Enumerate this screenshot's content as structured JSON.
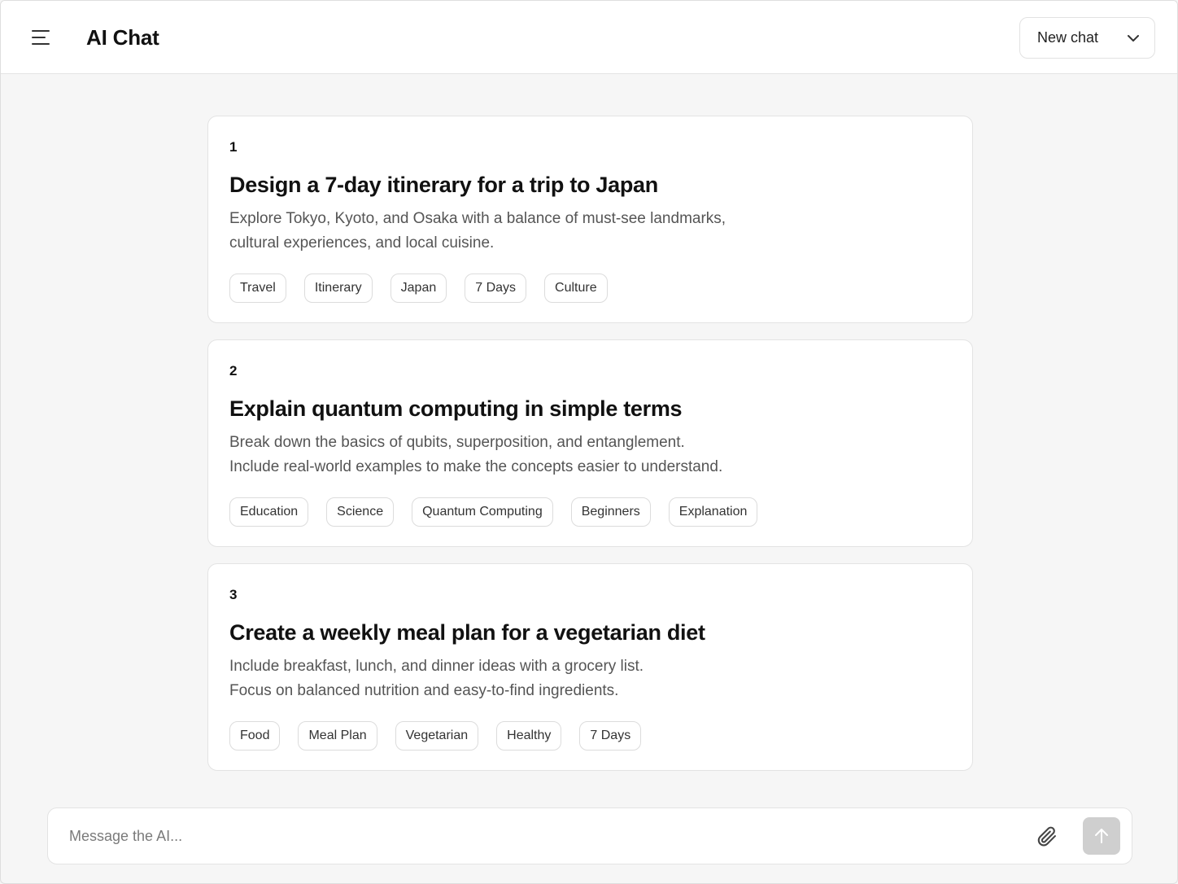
{
  "header": {
    "title": "AI Chat",
    "new_chat_label": "New chat"
  },
  "cards": [
    {
      "number": "1",
      "title": "Design a 7-day itinerary for a trip to Japan",
      "description_lines": [
        "Explore Tokyo, Kyoto, and Osaka with a balance of must-see landmarks,",
        "cultural experiences, and local cuisine."
      ],
      "tags": [
        "Travel",
        "Itinerary",
        "Japan",
        "7 Days",
        "Culture"
      ]
    },
    {
      "number": "2",
      "title": "Explain quantum computing in simple terms",
      "description_lines": [
        "Break down the basics of qubits, superposition, and entanglement.",
        "Include real-world examples to make the concepts easier to understand."
      ],
      "tags": [
        "Education",
        "Science",
        "Quantum Computing",
        "Beginners",
        "Explanation"
      ]
    },
    {
      "number": "3",
      "title": "Create a weekly meal plan for a vegetarian diet",
      "description_lines": [
        "Include breakfast, lunch, and dinner ideas with a grocery list.",
        "Focus on balanced nutrition and easy-to-find ingredients."
      ],
      "tags": [
        "Food",
        "Meal Plan",
        "Vegetarian",
        "Healthy",
        "7 Days"
      ]
    }
  ],
  "composer": {
    "placeholder": "Message the AI...",
    "value": ""
  },
  "icons": {
    "menu": "hamburger-menu-icon",
    "dropdown": "chevron-down-icon",
    "attach": "paperclip-icon",
    "send": "arrow-up-icon"
  },
  "colors": {
    "background": "#f6f6f6",
    "surface": "#ffffff",
    "border": "#e3e3e3",
    "send_button": "#cfcfcf",
    "muted_text": "#555555"
  }
}
